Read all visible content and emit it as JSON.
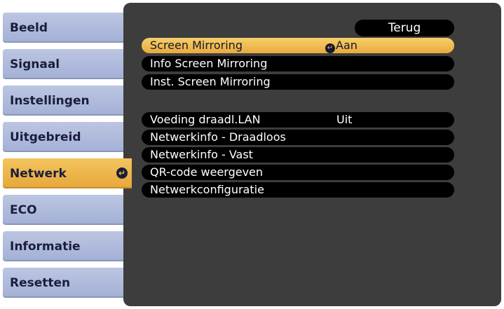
{
  "sidebar": {
    "items": [
      {
        "label": "Beeld"
      },
      {
        "label": "Signaal"
      },
      {
        "label": "Instellingen"
      },
      {
        "label": "Uitgebreid"
      },
      {
        "label": "Netwerk"
      },
      {
        "label": "ECO"
      },
      {
        "label": "Informatie"
      },
      {
        "label": "Resetten"
      }
    ],
    "active_index": 4
  },
  "panel": {
    "back_label": "Terug",
    "items": [
      {
        "label": "Screen Mirroring",
        "value": "Aan"
      },
      {
        "label": "Info Screen Mirroring"
      },
      {
        "label": "Inst. Screen Mirroring"
      },
      {
        "label": "Voeding draadl.LAN",
        "value": "Uit"
      },
      {
        "label": "Netwerkinfo - Draadloos"
      },
      {
        "label": "Netwerkinfo - Vast"
      },
      {
        "label": "QR-code weergeven"
      },
      {
        "label": "Netwerkconfiguratie"
      }
    ],
    "selected_index": 0
  },
  "colors": {
    "active": "#f0b44a",
    "tab": "#b0bbdc",
    "panel": "#3d3d3d"
  }
}
